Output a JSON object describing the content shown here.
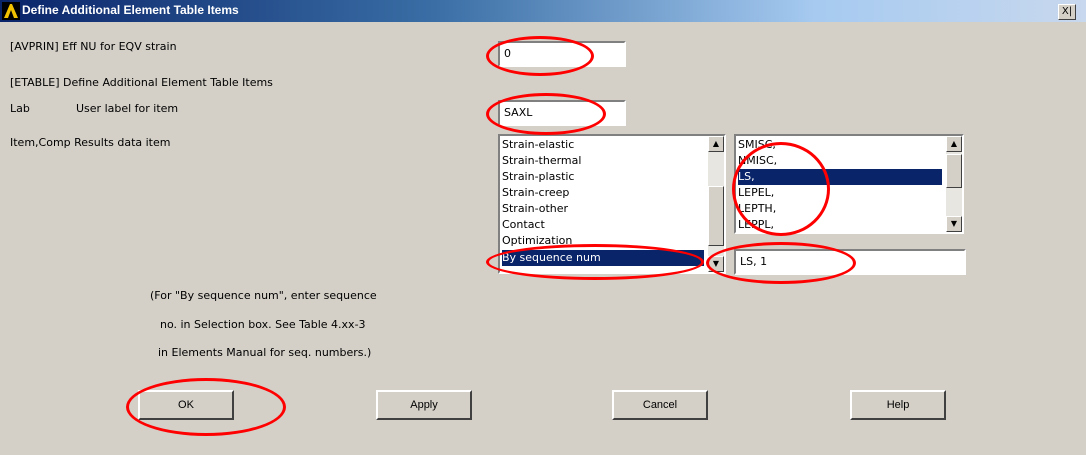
{
  "window": {
    "title": "Define Additional Element Table Items",
    "close_glyph": "X|",
    "logo_icon": "ansys-logo-icon"
  },
  "rows": {
    "avprin_label": "[AVPRIN]  Eff NU for EQV strain",
    "avprin_value": "0",
    "etable_label": "[ETABLE]  Define Additional Element Table Items",
    "lab_label": "Lab",
    "lab_desc": "User label for item",
    "lab_value": "SAXL",
    "item_label": "Item,Comp  Results data item"
  },
  "item_list": {
    "items": [
      "Strain-elastic",
      "Strain-thermal",
      "Strain-plastic",
      "Strain-creep",
      "Strain-other",
      "Contact",
      "Optimization",
      "By sequence num"
    ],
    "selected": "By sequence num"
  },
  "comp_list": {
    "items": [
      "SMISC,",
      "NMISC,",
      "LS,",
      "LEPEL,",
      "LEPTH,",
      "LEPPL,"
    ],
    "selected": "LS,"
  },
  "selection_value": "LS, 1",
  "note_lines": [
    "(For \"By sequence num\", enter sequence",
    "no. in Selection box.  See Table 4.xx-3",
    "in Elements Manual for seq. numbers.)"
  ],
  "buttons": {
    "ok": "OK",
    "apply": "Apply",
    "cancel": "Cancel",
    "help": "Help"
  },
  "colors": {
    "highlight_circle": "#ff0000",
    "selection_bg": "#0a246a",
    "dialog_bg": "#d4d0c8",
    "title_start": "#0a246a"
  }
}
